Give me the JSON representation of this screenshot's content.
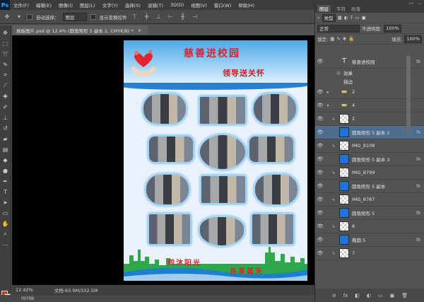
{
  "app": {
    "logo": "Ps"
  },
  "menu": [
    "文件(F)",
    "编辑(E)",
    "图像(I)",
    "图层(L)",
    "文字(Y)",
    "选择(S)",
    "滤镜(T)",
    "3D(D)",
    "视图(V)",
    "窗口(W)",
    "帮助(H)"
  ],
  "window_controls": [
    "–",
    "□",
    "×"
  ],
  "options": {
    "auto_select_label": "自动选择：",
    "auto_select_value": "图层",
    "transform_label": "显示变换控件"
  },
  "document": {
    "tab_title": "展板图片.psd @ 12.4% (圆角矩形 5 副本 2, CMYK/8) *",
    "close_glyph": "×"
  },
  "poster": {
    "title": "慈善进校园",
    "subtitle": "领导送关怀",
    "slogan_left": "同沐阳光",
    "slogan_right": "共享蓝天"
  },
  "statusbar": {
    "zoom": "12.42%",
    "doc_size": "文档:63.9M/332.5M"
  },
  "bottom_strip": {
    "label": "时间轴"
  },
  "layers_panel": {
    "tabs": [
      "图层",
      "字符",
      "段落"
    ],
    "active_tab": "图层",
    "filter_label": "类型",
    "blend_mode": "正常",
    "opacity_label": "不透明度:",
    "opacity_value": "100%",
    "lock_label": "锁定:",
    "fill_label": "填充:",
    "fill_value": "100%",
    "fx_label": "fx",
    "layers": [
      {
        "name": "慈善进校园",
        "kind": "text",
        "fx": true,
        "selected": false,
        "indent": 0
      },
      {
        "name": "效果",
        "kind": "sub",
        "fx": false,
        "selected": false,
        "indent": 1
      },
      {
        "name": "描边",
        "kind": "sub",
        "fx": false,
        "selected": false,
        "indent": 2
      },
      {
        "name": "2",
        "kind": "folder",
        "fx": false,
        "selected": false,
        "indent": 0
      },
      {
        "name": "4",
        "kind": "folder",
        "fx": false,
        "selected": false,
        "indent": 0
      },
      {
        "name": "2",
        "kind": "image",
        "fx": false,
        "selected": false,
        "indent": 1
      },
      {
        "name": "圆角矩形 5 副本 2",
        "kind": "shape",
        "fx": true,
        "selected": true,
        "indent": 1
      },
      {
        "name": "IMG_9108",
        "kind": "image",
        "fx": false,
        "selected": false,
        "indent": 1
      },
      {
        "name": "圆角矩形 5 副本 3",
        "kind": "shape",
        "fx": true,
        "selected": false,
        "indent": 1
      },
      {
        "name": "IMG_8799",
        "kind": "image",
        "fx": false,
        "selected": false,
        "indent": 1
      },
      {
        "name": "圆角矩形 5 副本",
        "kind": "shape",
        "fx": true,
        "selected": false,
        "indent": 1
      },
      {
        "name": "IMG_8787",
        "kind": "image",
        "fx": false,
        "selected": false,
        "indent": 1
      },
      {
        "name": "圆角矩形 5",
        "kind": "shape",
        "fx": true,
        "selected": false,
        "indent": 1
      },
      {
        "name": "8",
        "kind": "image",
        "fx": false,
        "selected": false,
        "indent": 1
      },
      {
        "name": "椭圆 5",
        "kind": "shape",
        "fx": true,
        "selected": false,
        "indent": 1
      },
      {
        "name": "7",
        "kind": "image",
        "fx": false,
        "selected": false,
        "indent": 1
      }
    ],
    "footer_icons": [
      "⊖",
      "fx",
      "◧",
      "◐",
      "▭",
      "▣",
      "🗑"
    ]
  },
  "colors": {
    "accent": "#4f6d8e",
    "poster_red": "#d9252a",
    "foreground": "#c83a12",
    "background": "#ffffff"
  }
}
